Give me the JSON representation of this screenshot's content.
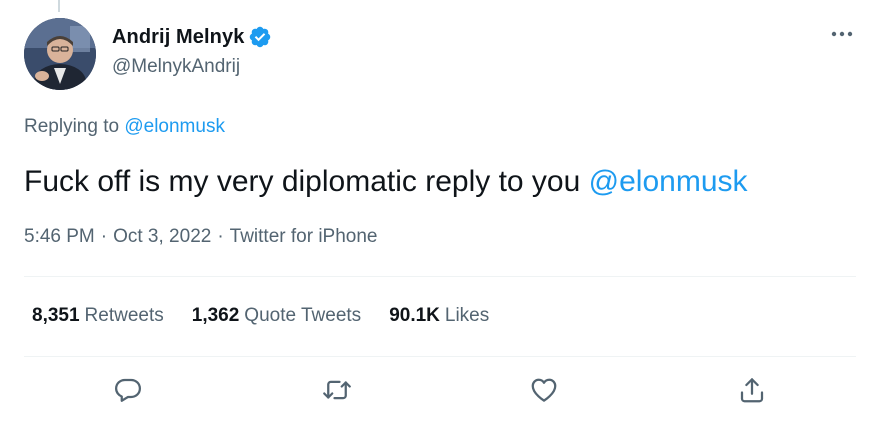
{
  "author": {
    "display_name": "Andrij Melnyk",
    "handle": "@MelnykAndrij",
    "verified": true
  },
  "reply_context": {
    "prefix": "Replying to",
    "mention": "@elonmusk"
  },
  "tweet": {
    "text": "Fuck off is my very diplomatic reply to you",
    "mention": "@elonmusk"
  },
  "meta": {
    "time": "5:46 PM",
    "separator": "·",
    "date": "Oct 3, 2022",
    "source": "Twitter for iPhone"
  },
  "stats": [
    {
      "count": "8,351",
      "label": "Retweets"
    },
    {
      "count": "1,362",
      "label": "Quote Tweets"
    },
    {
      "count": "90.1K",
      "label": "Likes"
    }
  ],
  "actions": [
    "reply-icon",
    "retweet-icon",
    "like-icon",
    "share-icon"
  ],
  "colors": {
    "accent": "#1d9bf0",
    "secondary_text": "#536471",
    "primary_text": "#0f1419",
    "divider": "#eff3f4"
  }
}
